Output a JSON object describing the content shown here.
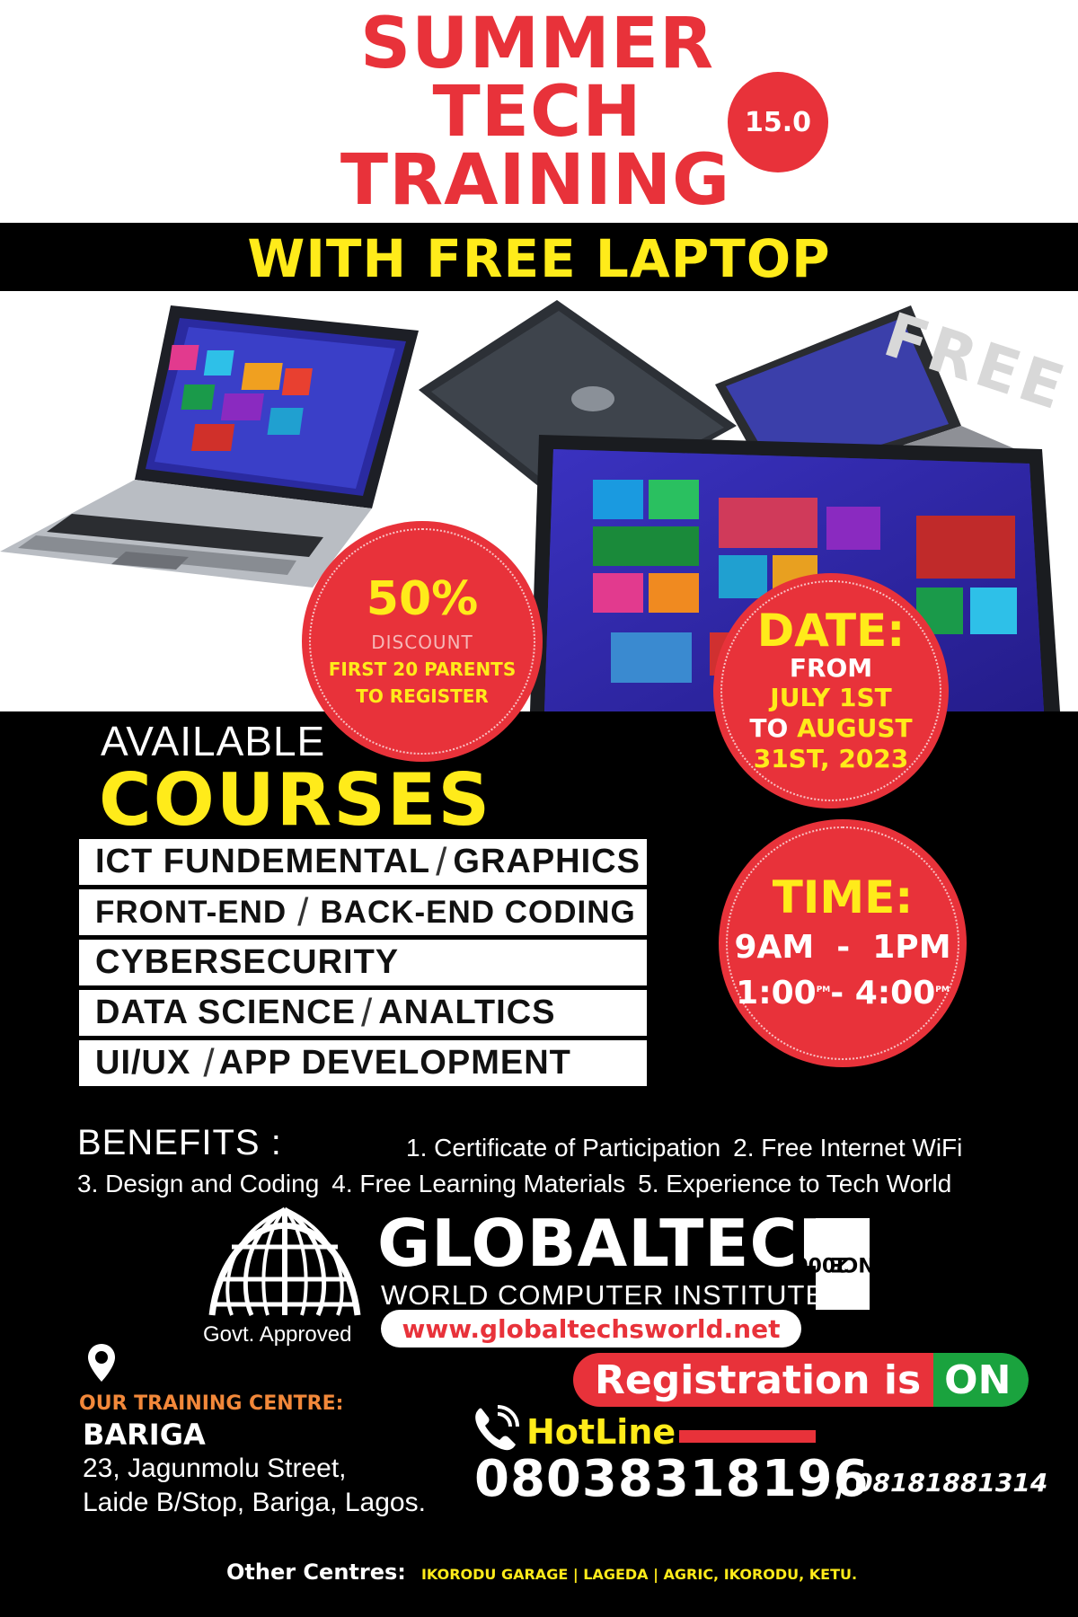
{
  "header": {
    "title_line1": "SUMMER",
    "title_line2": "TECH",
    "title_line3": "TRAINING",
    "edition": "15.0",
    "subtitle": "WITH FREE LAPTOP",
    "free_watermark": "FREE"
  },
  "discount": {
    "percent": "50%",
    "word": "DISCOUNT",
    "line1": "FIRST 20 PARENTS",
    "line2": "TO REGISTER"
  },
  "date": {
    "heading": "DATE:",
    "from": "FROM",
    "start": "JULY 1ST",
    "to": "TO",
    "end_month": "AUGUST",
    "end_day": "31ST, 2023"
  },
  "time": {
    "heading": "TIME:",
    "slot1": "9AM  -  1PM",
    "slot2_start": "1:00",
    "slot2_start_sup": "PM",
    "slot2_dash": "- ",
    "slot2_end": "4:00",
    "slot2_end_sup": "PM"
  },
  "courses": {
    "available": "AVAILABLE",
    "heading": "COURSES",
    "items": [
      {
        "a": "ICT FUNDEMENTAL",
        "sep": "/",
        "b": "GRAPHICS"
      },
      {
        "a": "FRONT-END",
        "sep": "/",
        "b": "BACK-END CODING"
      },
      {
        "a": "CYBERSECURITY",
        "sep": "",
        "b": ""
      },
      {
        "a": "DATA SCIENCE",
        "sep": "/",
        "b": "ANALTICS"
      },
      {
        "a": "UI/UX",
        "sep": "/",
        "b": "APP DEVELOPMENT"
      }
    ]
  },
  "benefits": {
    "heading": "BENEFITS :",
    "items": [
      "1. Certificate of Participation",
      "2. Free Internet WiFi",
      "3. Design and Coding",
      "4. Free Learning Materials",
      "5. Experience to Tech World"
    ]
  },
  "brand": {
    "name": "GLOBALTECH",
    "subtitle": "WORLD COMPUTER INSTITUTE",
    "since_label": "SINCE",
    "since_year": "2000",
    "approved": "Govt. Approved",
    "website": "www.globaltechsworld.net",
    "logo_icon": "globe-icon"
  },
  "location": {
    "label": "OUR TRAINING CENTRE:",
    "name": "BARIGA",
    "address_line1": "23, Jagunmolu Street,",
    "address_line2": "Laide B/Stop, Bariga, Lagos."
  },
  "registration": {
    "text": "Registration is",
    "status": "ON"
  },
  "hotline": {
    "label": "HotLine",
    "primary": "08038318196",
    "separator": "/",
    "secondary": "08181881314"
  },
  "other_centres": {
    "label": "Other Centres:",
    "list": "IKORODU GARAGE | LAGEDA | AGRIC, IKORODU, KETU."
  },
  "colors": {
    "accent_red": "#e8323a",
    "accent_yellow": "#ffeb1a",
    "accent_green": "#1aa33e",
    "accent_orange": "#f2883a"
  }
}
